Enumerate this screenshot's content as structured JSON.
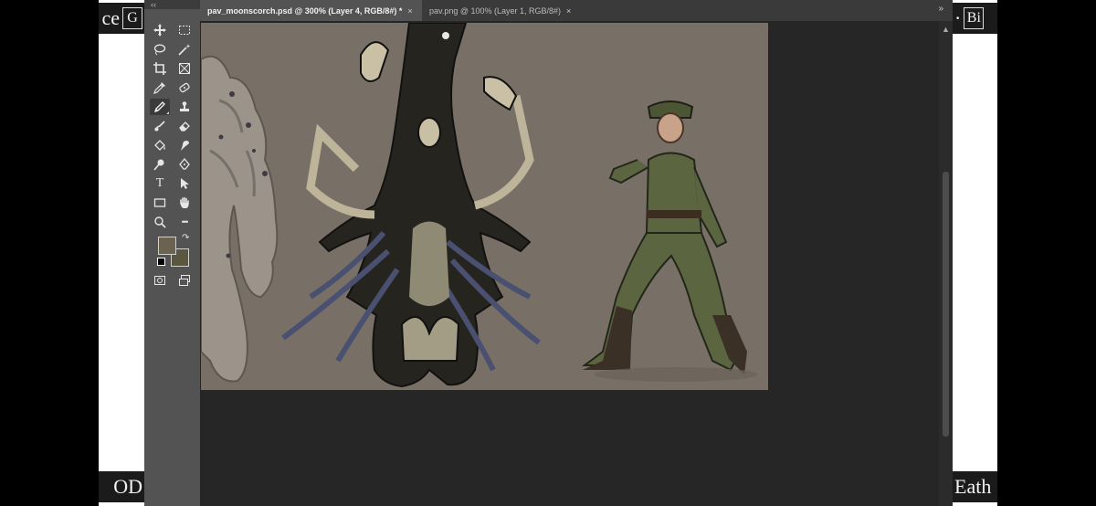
{
  "outer": {
    "left_top_text": "ce",
    "left_top_glyph": "G",
    "left_bottom_text": "OD",
    "right_top_text": "·",
    "right_top_glyph": "Bi",
    "right_bottom_text": "Eath"
  },
  "app": {
    "collapse_glyph": "‹‹",
    "tabs": [
      {
        "label": "pav_moonscorch.psd @ 300% (Layer 4, RGB/8#) *",
        "close": "×",
        "active": true
      },
      {
        "label": "pav.png @ 100% (Layer 1, RGB/8#)",
        "close": "×",
        "active": false
      }
    ],
    "tab_overflow": "»",
    "scroll_up": "▲"
  },
  "tools": [
    "move-tool",
    "rectangular-marquee-tool",
    "lasso-tool",
    "magic-wand-tool",
    "crop-tool",
    "frame-tool",
    "eyedropper-tool",
    "spot-healing-tool",
    "brush-tool",
    "clone-stamp-tool",
    "history-brush-tool",
    "eraser-tool",
    "paint-bucket-tool",
    "smudge-tool",
    "dodge-tool",
    "pen-tool",
    "type-tool",
    "path-selection-tool",
    "rectangle-tool",
    "hand-tool",
    "zoom-tool",
    "more-tools",
    "quick-mask-mode",
    "screen-mode"
  ],
  "text_tool_label": "T",
  "more_tools_label": "•••",
  "colors": {
    "foreground": "#6b6250",
    "background": "#5a5640",
    "canvas_bg": "#787067",
    "toolbar": "#535353",
    "workspace": "#262626"
  }
}
